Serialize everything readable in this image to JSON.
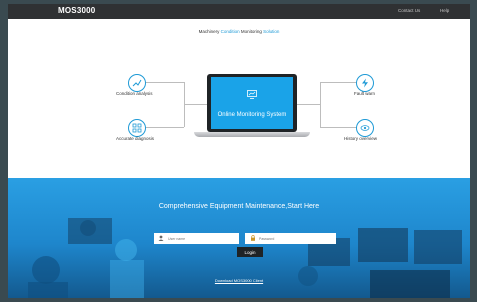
{
  "header": {
    "brand": "MOS3000",
    "nav": {
      "contact": "Contact Us",
      "help": "Help"
    }
  },
  "hero": {
    "tagline_prefix": "Machinery ",
    "tagline_highlight1": "Condition",
    "tagline_middle": " Monitoring ",
    "tagline_highlight2": "Solution",
    "center_label": "Online Monitoring System",
    "features": {
      "condition": "Condition analysis",
      "diagnosis": "Accurate diagnosis",
      "fault": "Fault warn",
      "history": "History overview"
    }
  },
  "login": {
    "title": "Comprehensive Equipment Maintenance,Start Here",
    "username_placeholder": "User name",
    "password_placeholder": "Password",
    "button_label": "Login",
    "download_link": "Download MOS3000 Client"
  },
  "colors": {
    "accent": "#1e9ad6",
    "topbar": "#2f3133",
    "panel_blue": "#1e86cc"
  }
}
